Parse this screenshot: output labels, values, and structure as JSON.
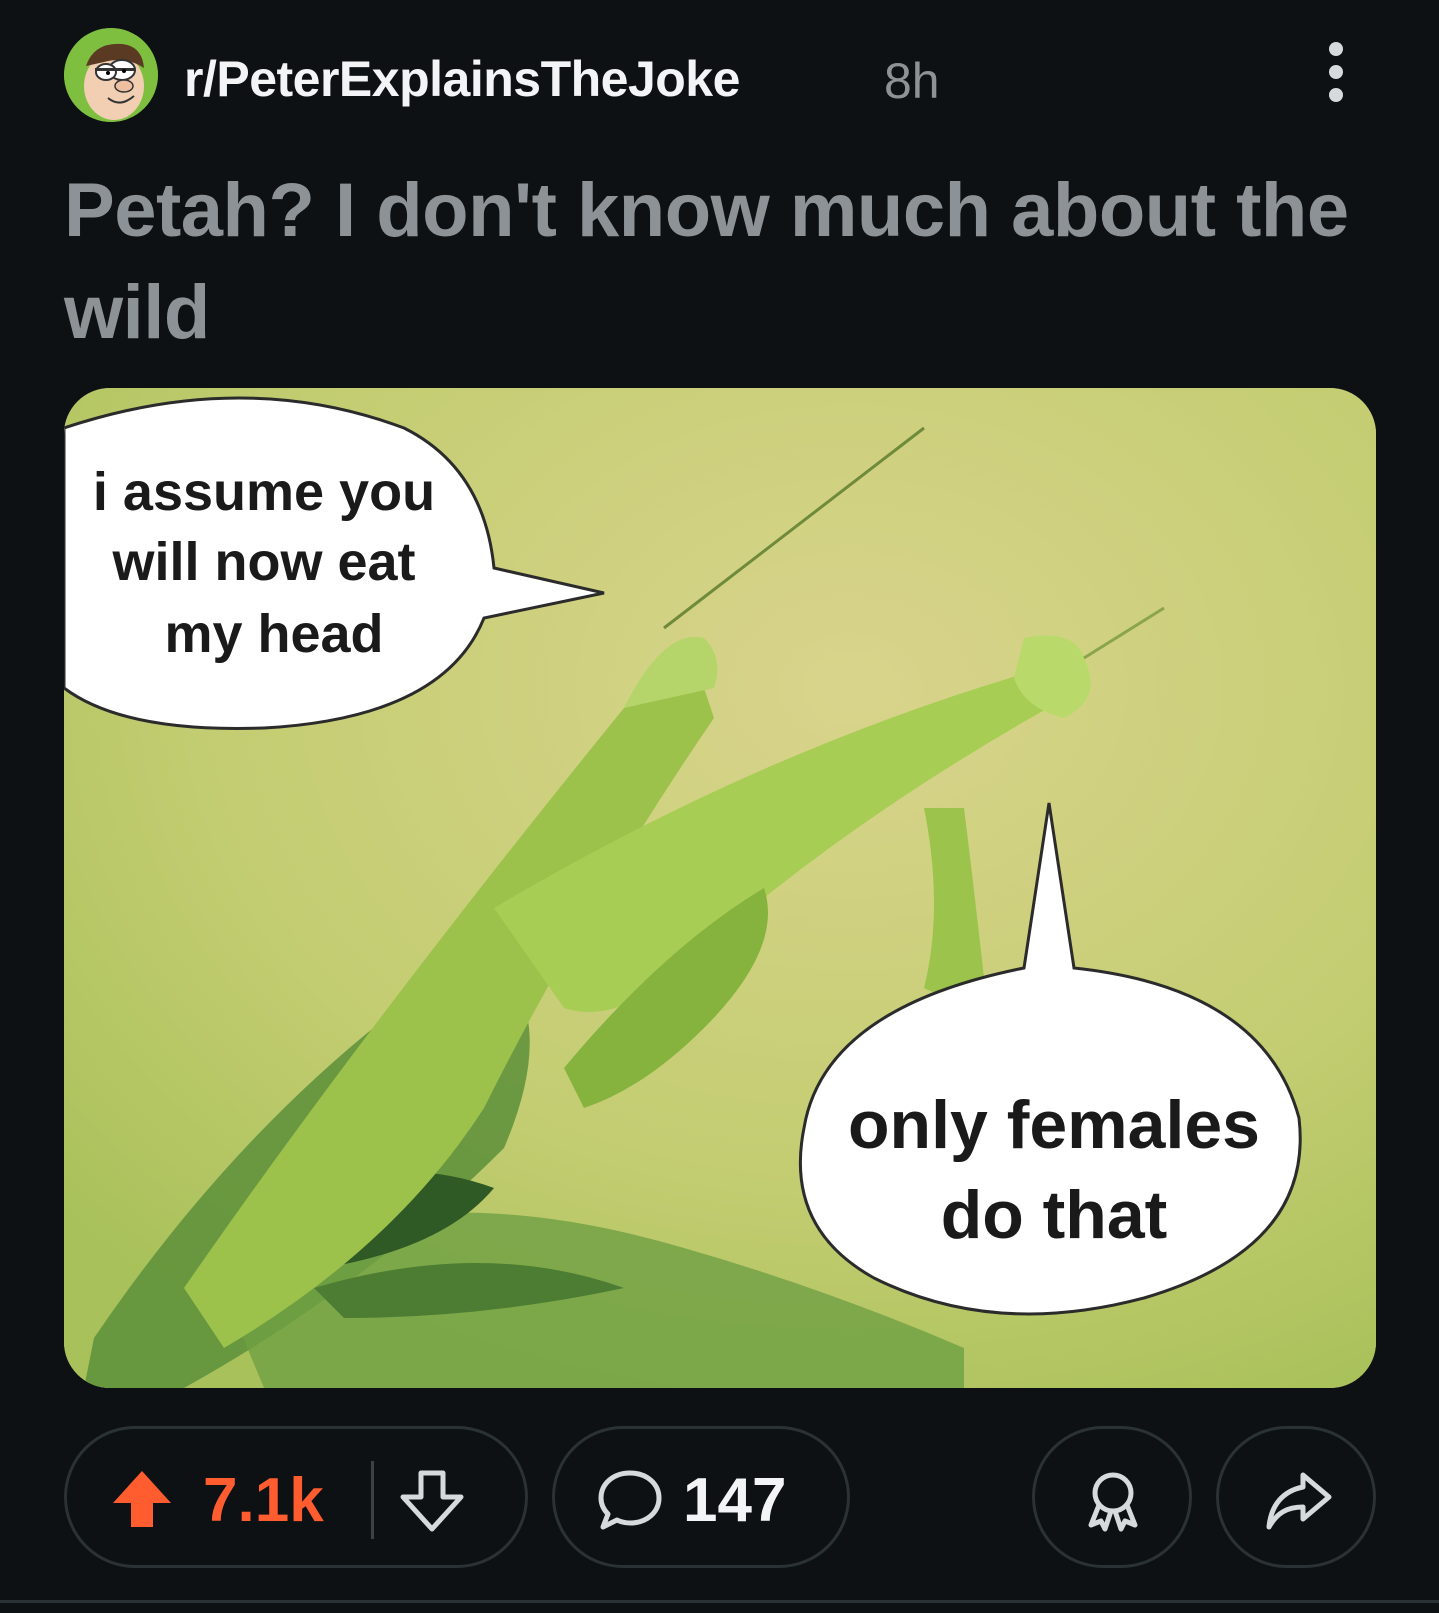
{
  "post": {
    "subreddit": "r/PeterExplainsTheJoke",
    "age": "8h",
    "title": "Petah? I don't know much about the wild"
  },
  "image": {
    "bubble_left": [
      "i assume you",
      "will now eat",
      "my head"
    ],
    "bubble_right": [
      "only females",
      "do that"
    ]
  },
  "actions": {
    "upvotes": "7.1k",
    "comments": "147"
  },
  "colors": {
    "background": "#0e1113",
    "upvote_accent": "#ff5d30",
    "muted_text": "#8d9297"
  },
  "icons": {
    "avatar": "peter-griffin-avatar",
    "more": "more-options-icon",
    "upvote": "upvote-arrow-icon",
    "downvote": "downvote-arrow-icon",
    "comment": "comment-bubble-icon",
    "award": "award-icon",
    "share": "share-arrow-icon"
  }
}
